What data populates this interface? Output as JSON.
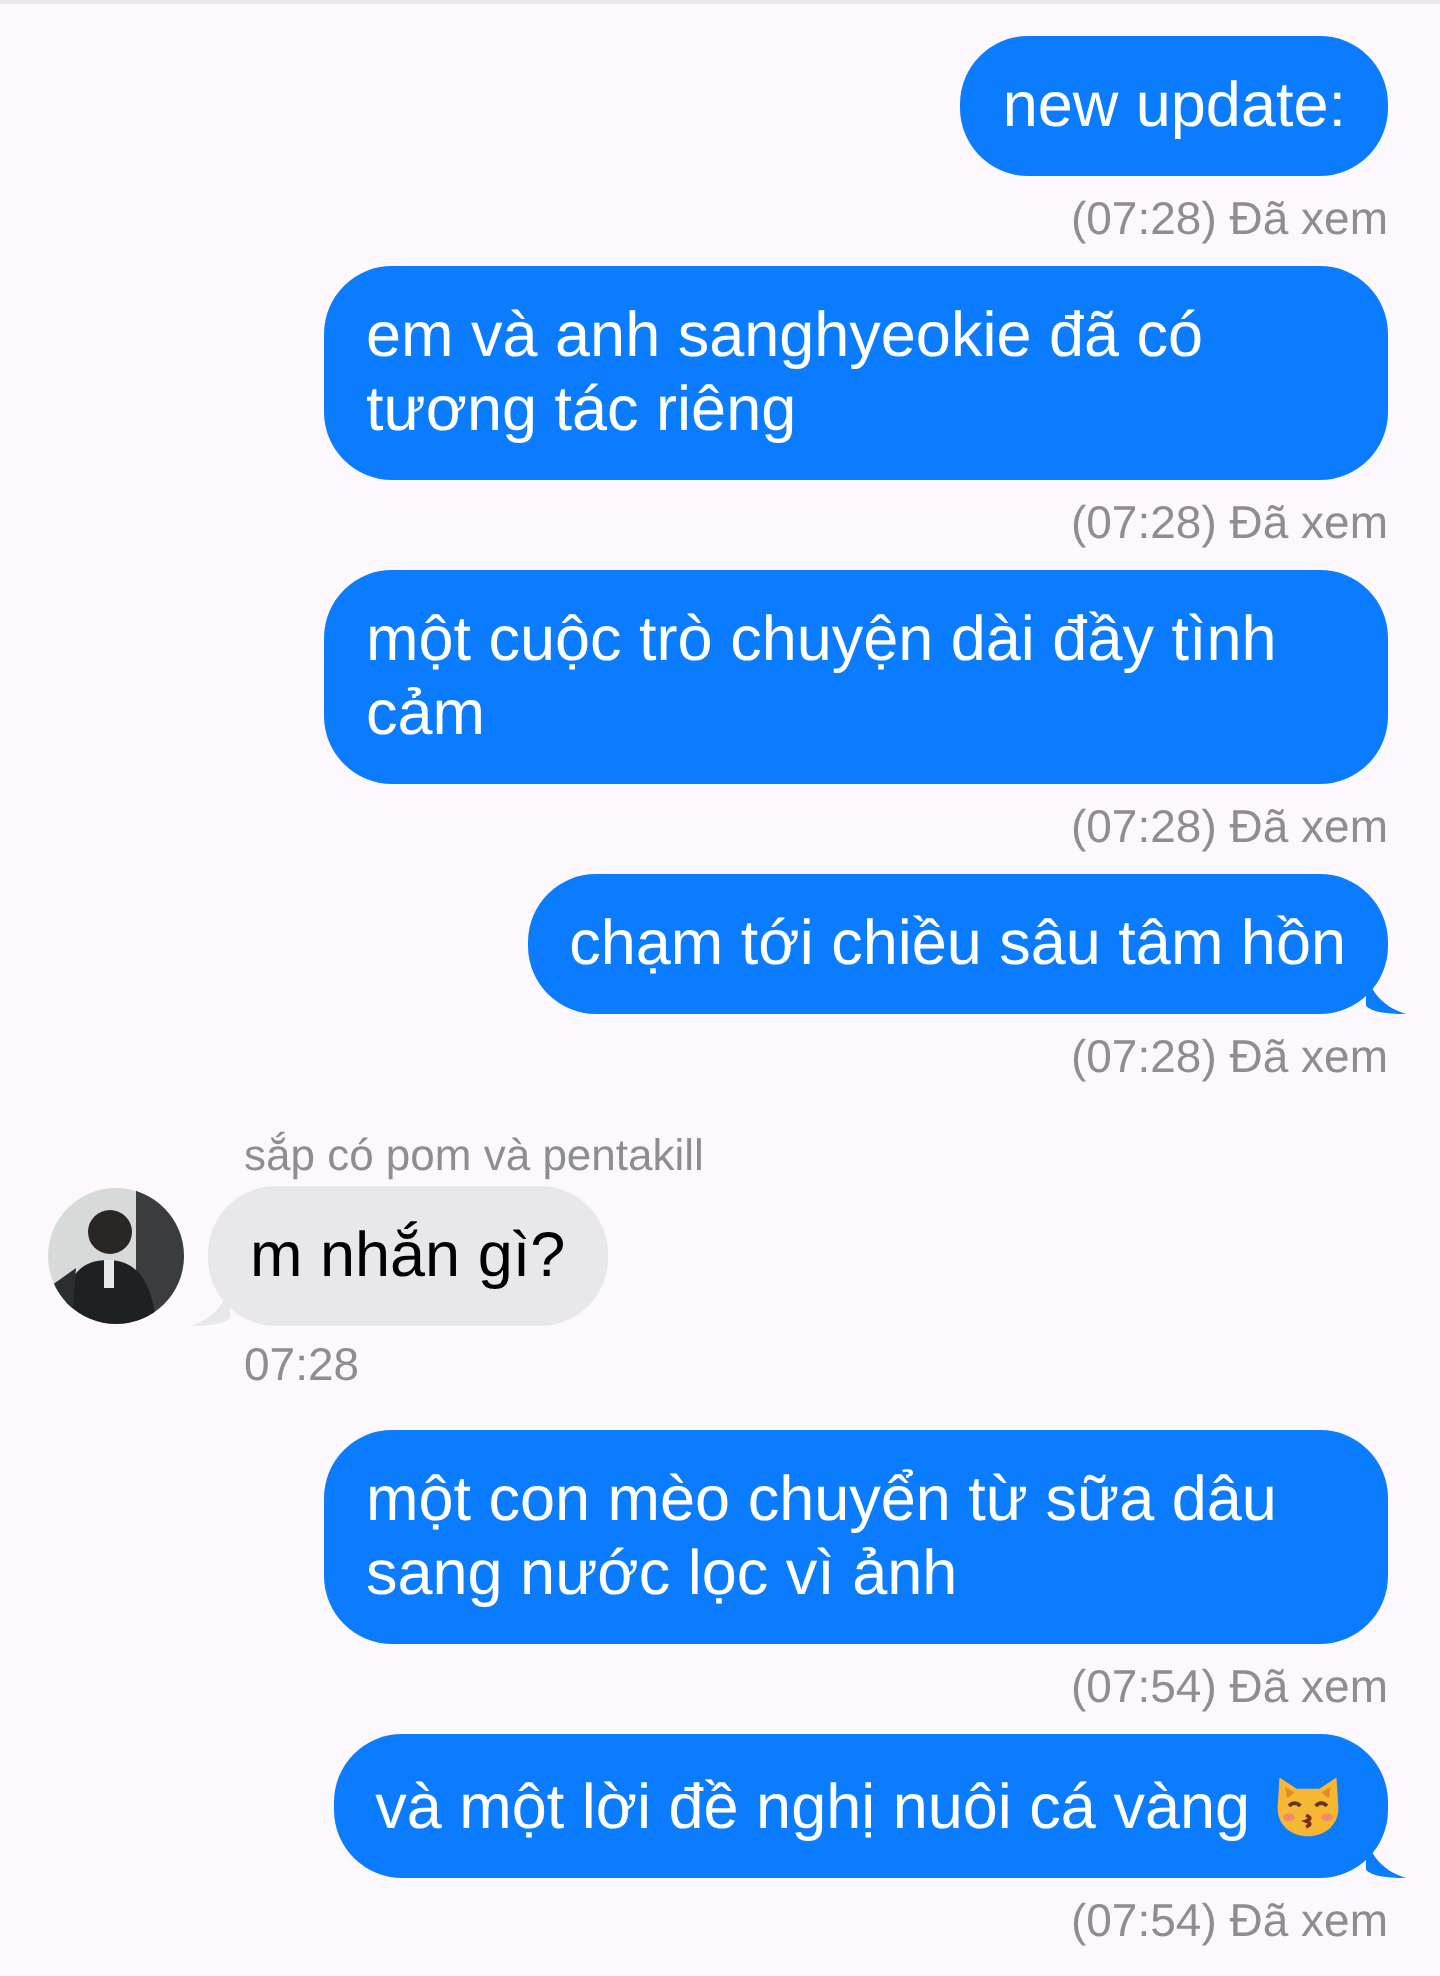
{
  "messages": [
    {
      "kind": "sent",
      "text": "new update:",
      "tail": false,
      "status": "(07:28) Đã xem"
    },
    {
      "kind": "sent",
      "text": "em và anh sanghyeokie đã có tương tác riêng",
      "tail": false,
      "status": "(07:28) Đã xem"
    },
    {
      "kind": "sent",
      "text": "một cuộc trò chuyện dài đầy tình cảm",
      "tail": false,
      "status": "(07:28) Đã xem"
    },
    {
      "kind": "sent",
      "text": "chạm tới chiều sâu tâm hồn",
      "tail": true,
      "status": "(07:28) Đã xem"
    },
    {
      "kind": "received",
      "sender": "sắp có pom và pentakill",
      "text": "m nhắn gì?",
      "tail": true,
      "status": "07:28"
    },
    {
      "kind": "sent",
      "text": "một con mèo chuyển từ sữa dâu sang nước lọc vì ảnh",
      "tail": false,
      "status": "(07:54) Đã xem"
    },
    {
      "kind": "sent",
      "text": "và một lời đề nghị nuôi cá vàng",
      "trailing_icon": true,
      "tail": true,
      "status": "(07:54) Đã xem"
    }
  ]
}
